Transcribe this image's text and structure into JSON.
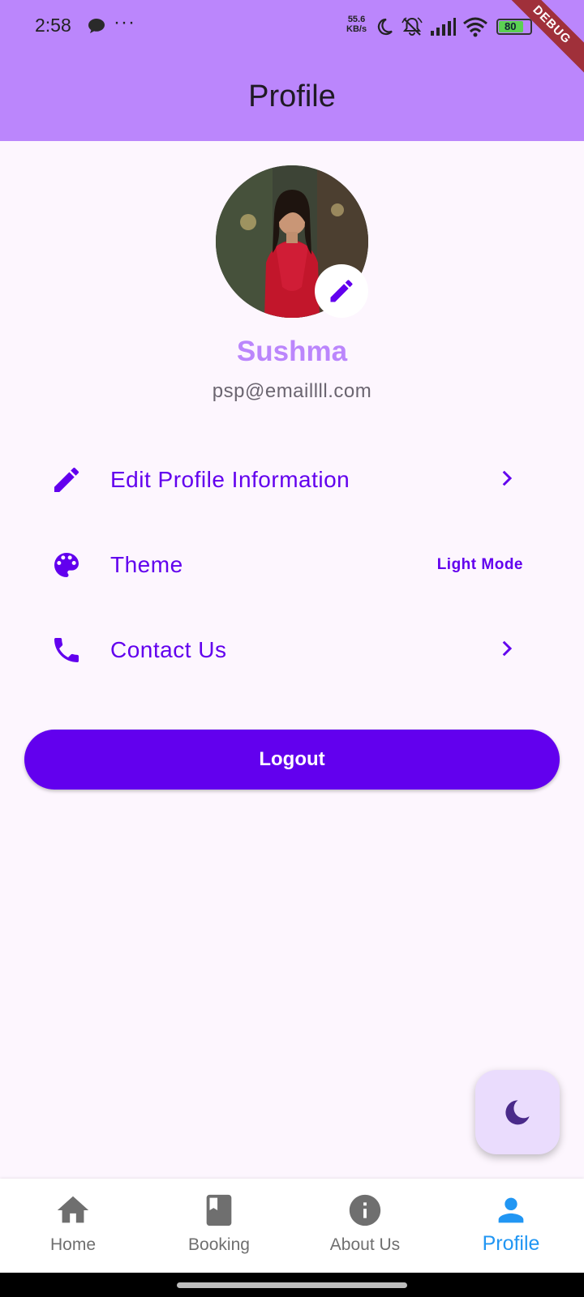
{
  "status_bar": {
    "time": "2:58",
    "net_speed_value": "55.6",
    "net_speed_unit": "KB/s",
    "battery": "80",
    "debug_banner": "DEBUG"
  },
  "app_bar": {
    "title": "Profile"
  },
  "profile": {
    "name": "Sushma",
    "email": "psp@emaillll.com"
  },
  "menu": {
    "items": [
      {
        "label": "Edit Profile Information",
        "icon": "pencil-icon"
      },
      {
        "label": "Theme",
        "icon": "palette-icon",
        "value": "Light Mode"
      },
      {
        "label": "Contact Us",
        "icon": "phone-icon"
      }
    ]
  },
  "logout": {
    "label": "Logout"
  },
  "fab": {
    "icon": "moon-icon"
  },
  "bottom_nav": {
    "items": [
      {
        "label": "Home",
        "icon": "home-icon"
      },
      {
        "label": "Booking",
        "icon": "book-icon"
      },
      {
        "label": "About Us",
        "icon": "info-icon"
      },
      {
        "label": "Profile",
        "icon": "person-icon"
      }
    ],
    "active": "Profile"
  },
  "colors": {
    "app_bar": "#bb86fc",
    "primary": "#6200ee",
    "background": "#fdf6fe",
    "active_nav": "#2196f3",
    "fab_bg": "#eadcfd"
  }
}
